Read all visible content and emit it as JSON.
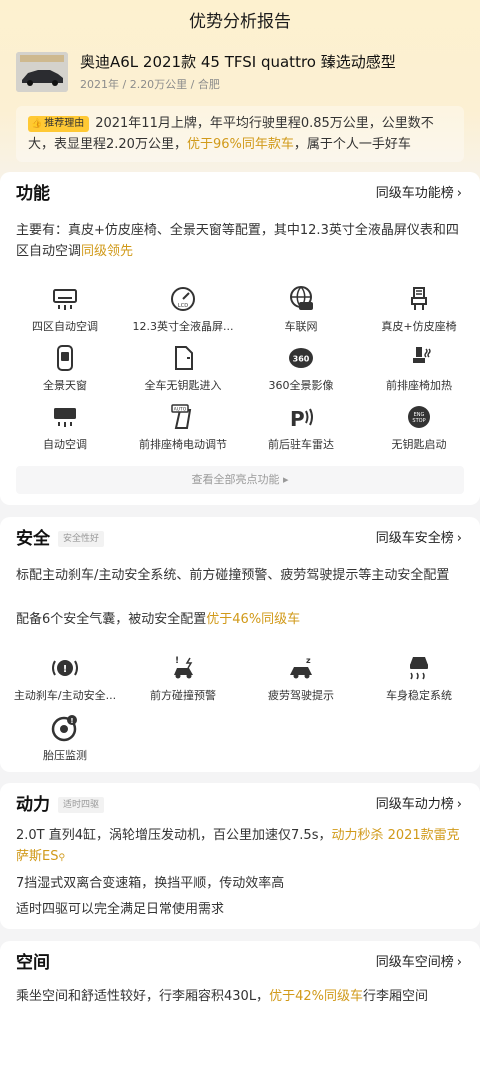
{
  "header": {
    "title": "优势分析报告"
  },
  "car": {
    "name": "奥迪A6L 2021款 45 TFSI quattro 臻选动感型",
    "subtitle": "2021年 / 2.20万公里 / 合肥",
    "thumb_text": "优势分析报告"
  },
  "recommend": {
    "badge": "推荐理由",
    "text_before": "2021年11月上牌，年平均行驶里程0.85万公里，公里数不大，表显里程2.20万公里，",
    "highlight": "优于96%同年款车",
    "text_after": "，属于个人一手好车"
  },
  "function": {
    "title": "功能",
    "link": "同级车功能榜",
    "summary_before": "主要有：真皮+仿皮座椅、全景天窗等配置，其中12.3英寸全液晶屏仪表和四区自动空调",
    "summary_highlight": "同级领先",
    "features": [
      {
        "label": "四区自动空调",
        "icon": "ac-icon"
      },
      {
        "label": "12.3英寸全液晶屏...",
        "icon": "lcd-gauge-icon"
      },
      {
        "label": "车联网",
        "icon": "connected-car-icon"
      },
      {
        "label": "真皮+仿皮座椅",
        "icon": "leather-seat-icon"
      },
      {
        "label": "全景天窗",
        "icon": "sunroof-icon"
      },
      {
        "label": "全车无钥匙进入",
        "icon": "keyless-entry-icon"
      },
      {
        "label": "360全景影像",
        "icon": "camera-360-icon"
      },
      {
        "label": "前排座椅加热",
        "icon": "seat-heating-icon"
      },
      {
        "label": "自动空调",
        "icon": "auto-ac-icon"
      },
      {
        "label": "前排座椅电动调节",
        "icon": "power-seat-icon"
      },
      {
        "label": "前后驻车雷达",
        "icon": "parking-radar-icon"
      },
      {
        "label": "无钥匙启动",
        "icon": "push-start-icon"
      }
    ],
    "more": "查看全部亮点功能"
  },
  "safety": {
    "title": "安全",
    "tag": "安全性好",
    "link": "同级车安全榜",
    "line1": "标配主动刹车/主动安全系统、前方碰撞预警、疲劳驾驶提示等主动安全配置",
    "line2_before": "配备6个安全气囊，被动安全配置",
    "line2_highlight": "优于46%同级车",
    "features": [
      {
        "label": "主动刹车/主动安全...",
        "icon": "active-brake-icon"
      },
      {
        "label": "前方碰撞预警",
        "icon": "collision-warning-icon"
      },
      {
        "label": "疲劳驾驶提示",
        "icon": "fatigue-alert-icon"
      },
      {
        "label": "车身稳定系统",
        "icon": "stability-control-icon"
      },
      {
        "label": "胎压监测",
        "icon": "tire-pressure-icon"
      }
    ]
  },
  "power": {
    "title": "动力",
    "tag": "适时四驱",
    "link": "同级车动力榜",
    "line1_before": "2.0T 直列4缸，涡轮增压发动机，百公里加速仅7.5s，",
    "line1_highlight": "动力秒杀 2021款雷克萨斯ES",
    "line2": "7挡湿式双离合变速箱，换挡平顺，传动效率高",
    "line3": "适时四驱可以完全满足日常使用需求"
  },
  "space": {
    "title": "空间",
    "link": "同级车空间榜",
    "line1_before": "乘坐空间和舒适性较好，行李厢容积430L，",
    "line1_highlight": "优于42%同级车",
    "line1_after": "行李厢空间"
  },
  "colors": {
    "accent": "#d19a1a",
    "badge": "#ffc934"
  }
}
